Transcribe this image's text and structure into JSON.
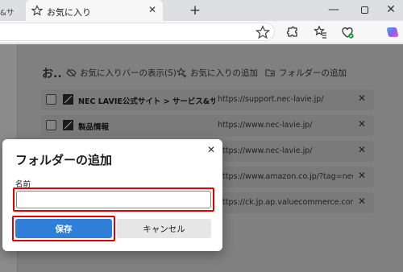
{
  "browser": {
    "prev_tab_title": "&サ",
    "active_tab_title": "お気に入り",
    "tab_close": "✕",
    "new_tab": "+",
    "window_minimize": "—",
    "window_close": "✕"
  },
  "favorites": {
    "heading": "お..",
    "actions": {
      "hide_bar": "お気に入りバーの表示(S)",
      "add_favorite": "お気に入りの追加",
      "add_folder": "フォルダーの追加"
    },
    "items": [
      {
        "name": "NEC LAVIE公式サイト > サービス&サポー...",
        "url": "https://support.nec-lavie.jp/"
      },
      {
        "name": "製品情報",
        "url": "https://www.nec-lavie.jp/"
      },
      {
        "name": "",
        "url": "https://www.nec-lavie.jp/"
      },
      {
        "name": "",
        "url": "https://www.amazon.co.jp/?tag=nec-edge..."
      },
      {
        "name": "",
        "url": "https://ck.jp.ap.valuecommerce.com/servl..."
      }
    ],
    "delete_glyph": "✕"
  },
  "dialog": {
    "title": "フォルダーの追加",
    "close_glyph": "✕",
    "name_label": "名前",
    "name_value": "",
    "save_label": "保存",
    "cancel_label": "キャンセル"
  },
  "colors": {
    "accent": "#2f7fd8",
    "highlight": "#e00000"
  }
}
